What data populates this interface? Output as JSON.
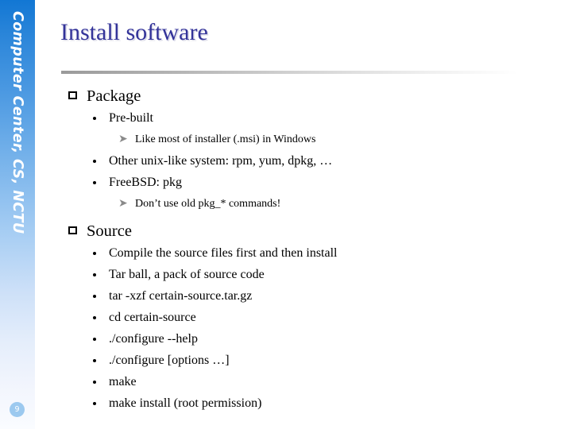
{
  "sidebar": {
    "vertical_label": "Computer Center, CS, NCTU",
    "page_number": "9",
    "gradient_top": "#1277d4",
    "gradient_bottom": "#fafcff",
    "page_number_bg": "#9cc9ef"
  },
  "slide": {
    "title": "Install software",
    "title_color": "#333399",
    "rule_color": "#9a9a9a",
    "background": "#ffffff"
  },
  "content": {
    "sections": [
      {
        "heading": "Package",
        "bullet_icon": "hollow-square-bullet",
        "items": [
          {
            "level": 2,
            "text": "Pre-built",
            "bullet_icon": "round-dot-bullet"
          },
          {
            "level": 3,
            "text": "Like most of installer (.msi)  in Windows",
            "bullet_icon": "gray-arrow-bullet"
          },
          {
            "level": 2,
            "text": "Other unix-like system: rpm, yum, dpkg, …",
            "bullet_icon": "round-dot-bullet"
          },
          {
            "level": 2,
            "text": "FreeBSD: pkg",
            "bullet_icon": "round-dot-bullet"
          },
          {
            "level": 3,
            "text": "Don’t use old pkg_* commands!",
            "bullet_icon": "gray-arrow-bullet"
          }
        ]
      },
      {
        "heading": "Source",
        "bullet_icon": "hollow-square-bullet",
        "items": [
          {
            "level": 2,
            "text": "Compile the source files first and then install",
            "bullet_icon": "round-dot-bullet"
          },
          {
            "level": 2,
            "text": "Tar ball, a pack of source code",
            "bullet_icon": "round-dot-bullet"
          },
          {
            "level": 2,
            "text": "tar -xzf certain-source.tar.gz",
            "bullet_icon": "round-dot-bullet"
          },
          {
            "level": 2,
            "text": "cd certain-source",
            "bullet_icon": "round-dot-bullet"
          },
          {
            "level": 2,
            "text": "./configure --help",
            "bullet_icon": "round-dot-bullet"
          },
          {
            "level": 2,
            "text": "./configure [options …]",
            "bullet_icon": "round-dot-bullet"
          },
          {
            "level": 2,
            "text": "make",
            "bullet_icon": "round-dot-bullet"
          },
          {
            "level": 2,
            "text": "make install (root permission)",
            "bullet_icon": "round-dot-bullet"
          }
        ]
      }
    ]
  }
}
